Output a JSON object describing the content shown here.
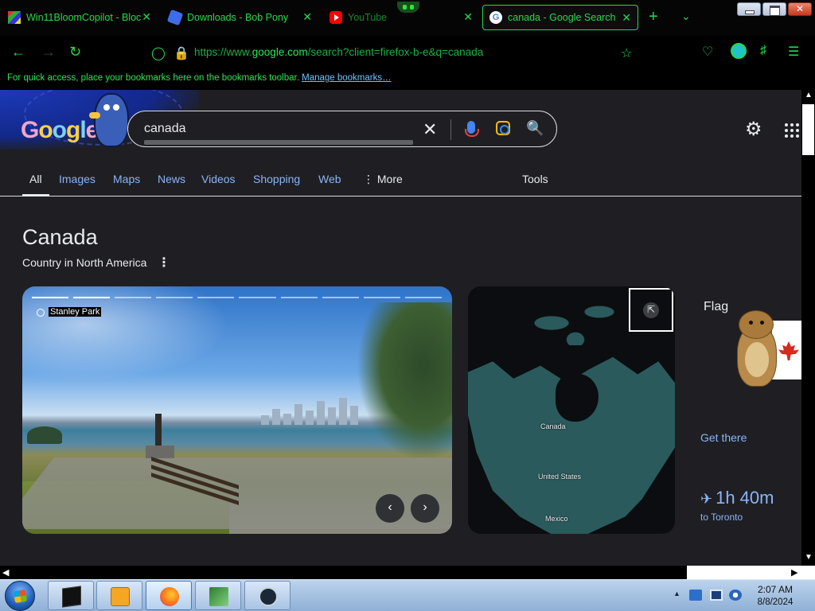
{
  "browser": {
    "tabs": [
      {
        "title": "Win11BloomCopilot - Bloc",
        "favicon": "mosaic-icon",
        "active": false
      },
      {
        "title": "Downloads - Bob Pony",
        "favicon": "puzzle-icon",
        "active": false
      },
      {
        "title": "YouTube",
        "favicon": "youtube-icon",
        "active": false
      },
      {
        "title": "canada - Google Search",
        "favicon": "google-icon",
        "active": true
      }
    ],
    "close_glyph": "✕",
    "new_tab_glyph": "+",
    "url_host_prefix": "https://www.",
    "url_host": "google.com",
    "url_rest": "/search?client=firefox-b-e&q=canada",
    "bookmarks_text": "For quick access, place your bookmarks here on the bookmarks toolbar.",
    "bookmarks_link": "Manage bookmarks…",
    "accent_color": "#25d94a"
  },
  "search": {
    "logo_letters": [
      "G",
      "o",
      "o",
      "g",
      "l",
      "e"
    ],
    "query": "canada",
    "tabs": [
      "All",
      "Images",
      "Maps",
      "News",
      "Videos",
      "Shopping",
      "Web"
    ],
    "more_label": "More",
    "tools_label": "Tools",
    "active_tab": "All"
  },
  "knowledge_panel": {
    "title": "Canada",
    "subtitle": "Country in North America",
    "photo_caption": "Stanley Park",
    "map_labels": {
      "canada": "Canada",
      "usa": "United States",
      "mexico": "Mexico"
    },
    "flag_label": "Flag",
    "get_there": "Get there",
    "flight_time": "1h 40m",
    "flight_destination": "to Toronto"
  },
  "taskbar": {
    "time": "2:07 AM",
    "date": "8/8/2024",
    "apps": [
      "command-prompt-icon",
      "media-player-icon",
      "firefox-icon",
      "process-explorer-icon",
      "steam-icon"
    ],
    "active_app": "firefox-icon"
  }
}
